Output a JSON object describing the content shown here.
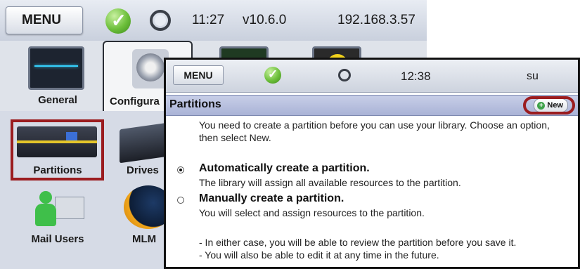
{
  "back_window": {
    "menu_label": "MENU",
    "time": "11:27",
    "version": "v10.6.0",
    "ip": "192.168.3.57",
    "tabs": [
      {
        "label": "General"
      },
      {
        "label": "Configura"
      }
    ],
    "tiles": [
      {
        "label": "Partitions"
      },
      {
        "label": "Drives"
      },
      {
        "label": "Mail Users"
      },
      {
        "label": "MLM"
      }
    ]
  },
  "front_window": {
    "menu_label": "MENU",
    "time": "12:38",
    "user": "su",
    "section_title": "Partitions",
    "new_button_label": "New",
    "intro": "You need to create a partition before you can use your library. Choose an option, then select New.",
    "options": [
      {
        "title": "Automatically create a partition.",
        "desc": "The library will assign all available resources to the partition.",
        "selected": true
      },
      {
        "title": "Manually create a partition.",
        "desc": "You will select and assign resources to the partition.",
        "selected": false
      }
    ],
    "notes": [
      "- In either case, you will be able to review the partition before you save it.",
      "- You will also be able to edit it at any time in the future."
    ]
  },
  "colors": {
    "highlight_red": "#9b1c1f",
    "status_green": "#6cbf3a",
    "title_bar_blue": "#a9b3d6"
  }
}
